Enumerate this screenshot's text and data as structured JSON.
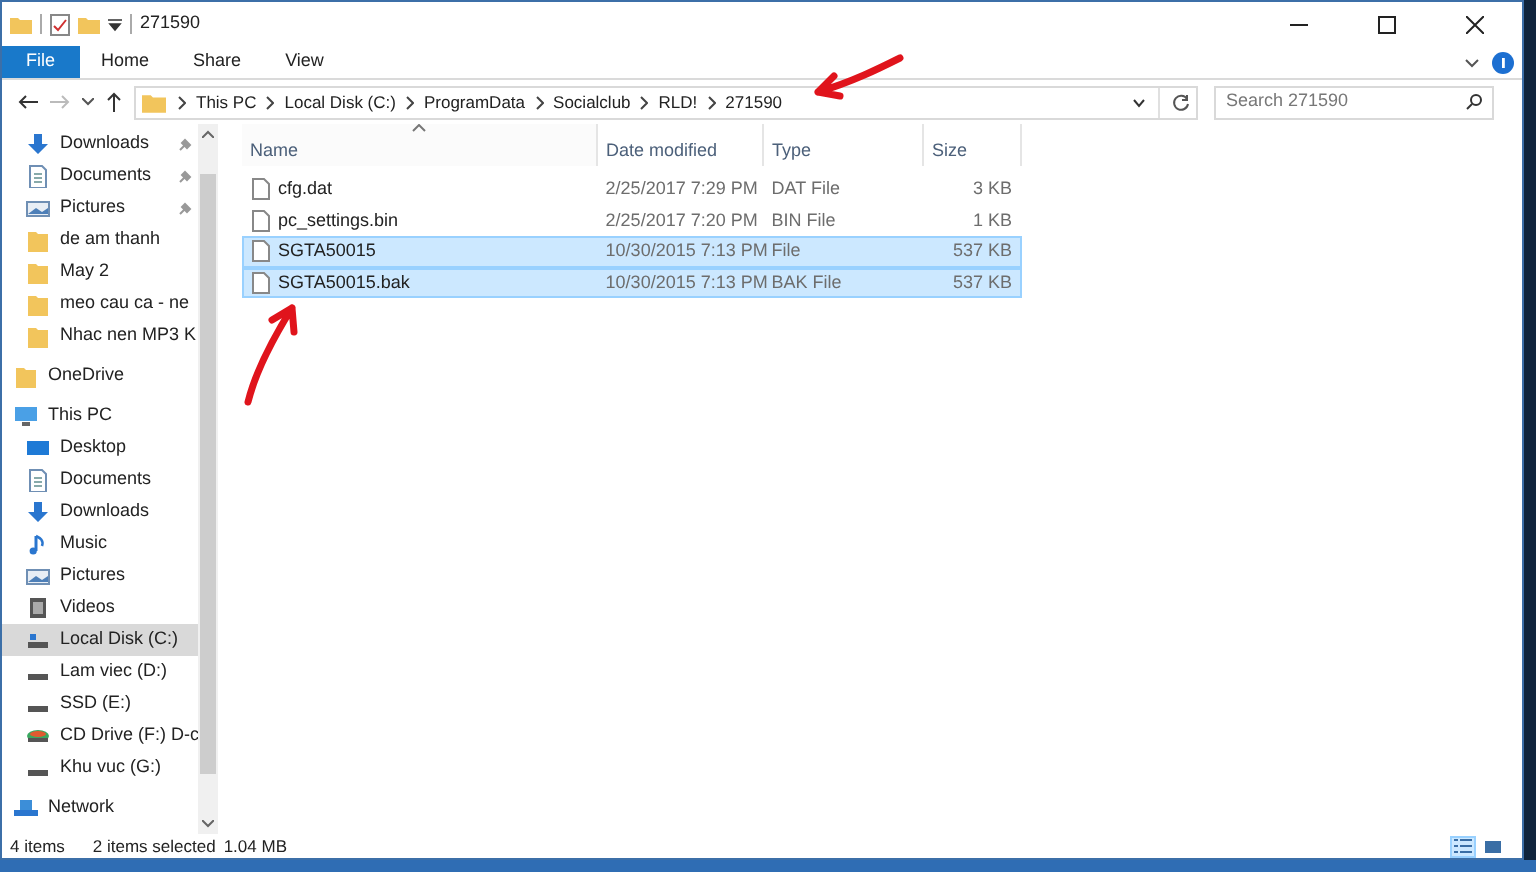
{
  "window": {
    "title": "271590"
  },
  "ribbon": {
    "tabs": [
      {
        "label": "File",
        "kind": "file",
        "selected": false
      },
      {
        "label": "Home",
        "kind": "tab",
        "selected": false
      },
      {
        "label": "Share",
        "kind": "tab",
        "selected": false
      },
      {
        "label": "View",
        "kind": "tab",
        "selected": false
      }
    ]
  },
  "address": {
    "breadcrumbs": [
      "This PC",
      "Local Disk (C:)",
      "ProgramData",
      "Socialclub",
      "RLD!",
      "271590"
    ]
  },
  "search": {
    "placeholder": "Search 271590"
  },
  "sidebar": {
    "quick_access": [
      {
        "label": "Downloads",
        "kind": "download",
        "pinned": true,
        "selected": false
      },
      {
        "label": "Documents",
        "kind": "document",
        "pinned": true,
        "selected": false
      },
      {
        "label": "Pictures",
        "kind": "picture",
        "pinned": true,
        "selected": false
      },
      {
        "label": "de am thanh",
        "kind": "folder",
        "pinned": false,
        "selected": false
      },
      {
        "label": "May 2",
        "kind": "folder",
        "pinned": false,
        "selected": false
      },
      {
        "label": "meo cau ca - ne",
        "kind": "folder",
        "pinned": false,
        "selected": false
      },
      {
        "label": "Nhac nen MP3 K",
        "kind": "folder",
        "pinned": false,
        "selected": false
      }
    ],
    "tree": [
      {
        "label": "OneDrive",
        "kind": "folder",
        "selected": false
      },
      {
        "label": "This PC",
        "kind": "pc",
        "selected": false,
        "children": [
          {
            "label": "Desktop",
            "kind": "desktop",
            "selected": false
          },
          {
            "label": "Documents",
            "kind": "document",
            "selected": false
          },
          {
            "label": "Downloads",
            "kind": "download",
            "selected": false
          },
          {
            "label": "Music",
            "kind": "music",
            "selected": false
          },
          {
            "label": "Pictures",
            "kind": "picture",
            "selected": false
          },
          {
            "label": "Videos",
            "kind": "video",
            "selected": false
          },
          {
            "label": "Local Disk (C:)",
            "kind": "system-disk",
            "selected": true
          },
          {
            "label": "Lam viec (D:)",
            "kind": "disk",
            "selected": false
          },
          {
            "label": "SSD (E:)",
            "kind": "disk",
            "selected": false
          },
          {
            "label": "CD Drive (F:) D-c",
            "kind": "cd",
            "selected": false
          },
          {
            "label": "Khu vuc (G:)",
            "kind": "disk",
            "selected": false
          }
        ]
      },
      {
        "label": "Network",
        "kind": "network",
        "selected": false
      }
    ]
  },
  "table": {
    "columns": [
      {
        "label": "Name",
        "sorted": true
      },
      {
        "label": "Date modified",
        "sorted": false
      },
      {
        "label": "Type",
        "sorted": false
      },
      {
        "label": "Size",
        "sorted": false
      }
    ],
    "rows": [
      {
        "name": "cfg.dat",
        "date": "2/25/2017 7:29 PM",
        "type": "DAT File",
        "size": "3 KB",
        "selected": false
      },
      {
        "name": "pc_settings.bin",
        "date": "2/25/2017 7:20 PM",
        "type": "BIN File",
        "size": "1 KB",
        "selected": false
      },
      {
        "name": "SGTA50015",
        "date": "10/30/2015 7:13 PM",
        "type": "File",
        "size": "537 KB",
        "selected": true
      },
      {
        "name": "SGTA50015.bak",
        "date": "10/30/2015 7:13 PM",
        "type": "BAK File",
        "size": "537 KB",
        "selected": true
      }
    ]
  },
  "status_bar": {
    "items": "4 items",
    "selection": "2 items selected",
    "size": "1.04 MB",
    "view_buttons": [
      {
        "kind": "details",
        "selected": true
      },
      {
        "kind": "large-icons",
        "selected": false
      }
    ]
  }
}
